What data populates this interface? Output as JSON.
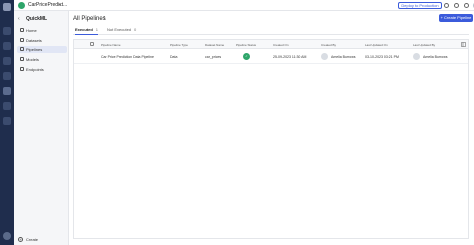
{
  "topbar": {
    "project_name": "CarPricePredict...",
    "deploy_label": "Deploy to Production"
  },
  "sidebar": {
    "title": "QuickML",
    "items": [
      {
        "label": "Home",
        "icon": "home-icon"
      },
      {
        "label": "Datasets",
        "icon": "datasets-icon"
      },
      {
        "label": "Pipelines",
        "icon": "pipelines-icon"
      },
      {
        "label": "Models",
        "icon": "models-icon"
      },
      {
        "label": "Endpoints",
        "icon": "endpoints-icon"
      }
    ],
    "create_label": "Create"
  },
  "main": {
    "title": "All Pipelines",
    "title_count": "1",
    "create_button": "+ Create Pipeline",
    "tabs": [
      {
        "label": "Executed",
        "count": "1"
      },
      {
        "label": "Not Executed",
        "count": "0"
      }
    ],
    "columns": [
      "Pipeline Name",
      "Pipeline Type",
      "Dataset Name",
      "Pipeline Status",
      "Created On",
      "Created By",
      "Last Updated On",
      "Last Updated By"
    ],
    "rows": [
      {
        "name": "Car Price Prediction Data Pipeline",
        "type": "Data",
        "dataset": "car_prices",
        "status": "✓",
        "created_on": "25-09-2023 11:30 AM",
        "created_by": "Amelia Burrows",
        "updated_on": "03-10-2023 03:21 PM",
        "updated_by": "Amelia Burrows"
      }
    ]
  }
}
